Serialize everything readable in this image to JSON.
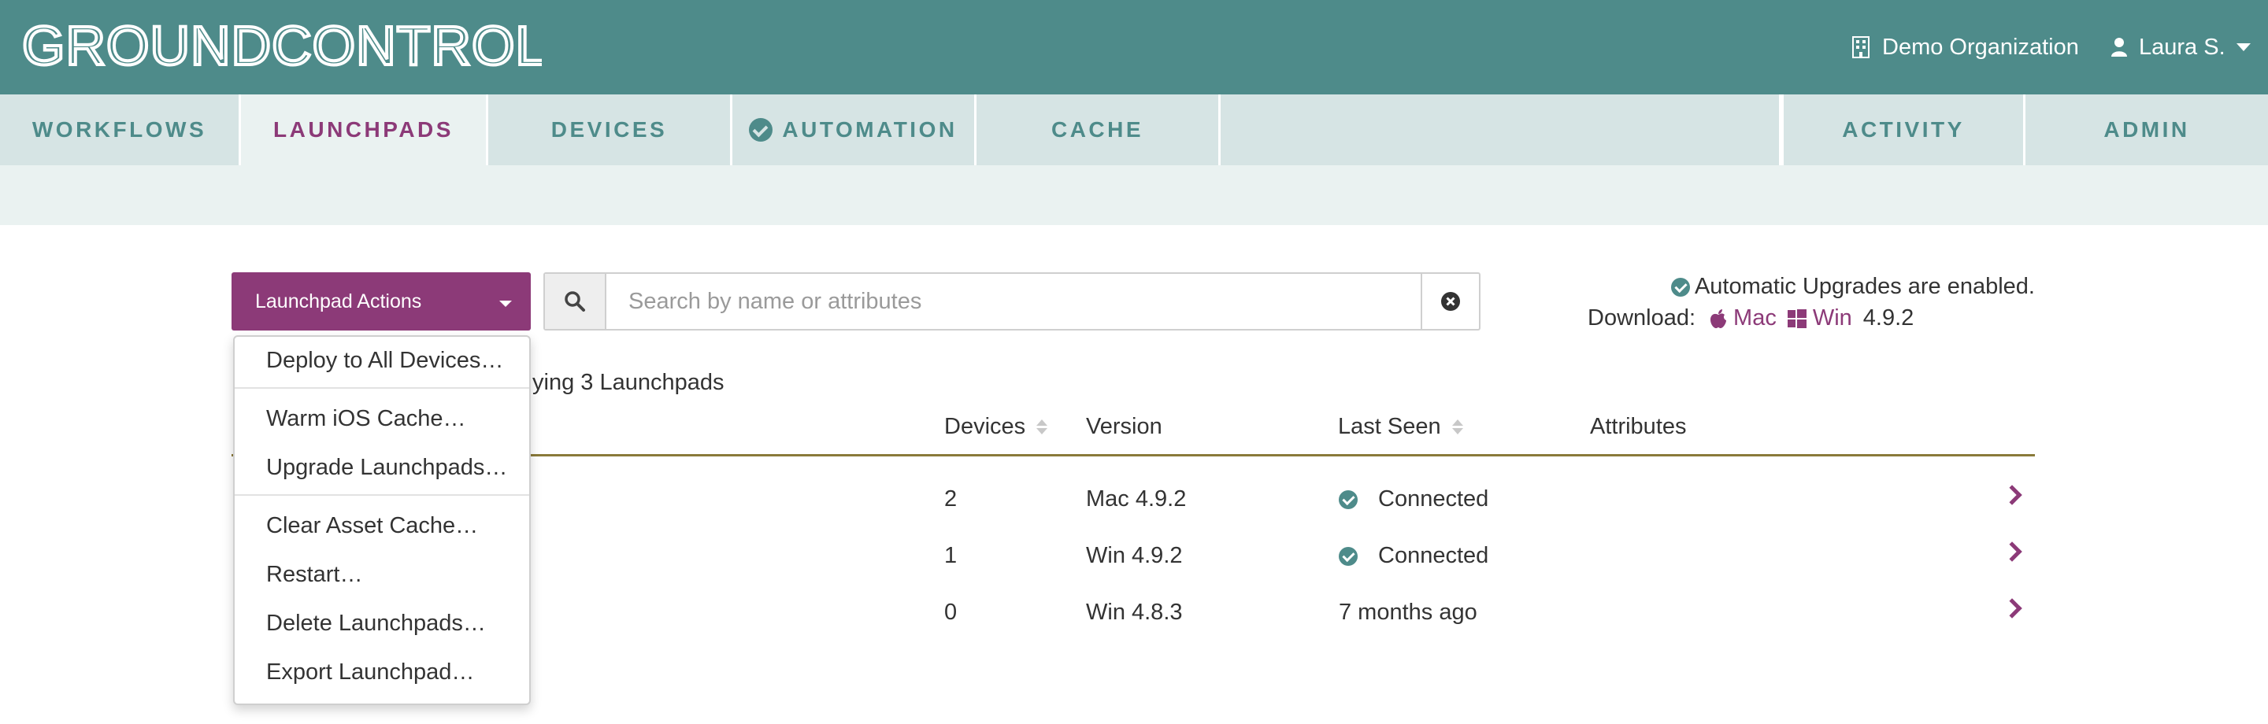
{
  "header": {
    "logo_text": "GROUNDCONTROL",
    "org_label": "Demo Organization",
    "user_label": "Laura S."
  },
  "nav": {
    "tabs": [
      {
        "label": "WORKFLOWS"
      },
      {
        "label": "LAUNCHPADS"
      },
      {
        "label": "DEVICES"
      },
      {
        "label": "AUTOMATION"
      },
      {
        "label": "CACHE"
      },
      {
        "label": "ACTIVITY"
      },
      {
        "label": "ADMIN"
      }
    ]
  },
  "toolbar": {
    "actions_label": "Launchpad Actions",
    "search_placeholder": "Search by name or attributes"
  },
  "status": {
    "upgrades_text": "Automatic Upgrades are enabled.",
    "download_label": "Download:",
    "mac_label": "Mac",
    "win_label": "Win",
    "version": "4.9.2"
  },
  "menu": {
    "items": [
      {
        "label": "Deploy to All Devices…"
      },
      {
        "label": "Warm iOS Cache…"
      },
      {
        "label": "Upgrade Launchpads…"
      },
      {
        "label": "Clear Asset Cache…"
      },
      {
        "label": "Restart…"
      },
      {
        "label": "Delete Launchpads…"
      },
      {
        "label": "Export Launchpad…"
      }
    ]
  },
  "table": {
    "showing_text": "ying 3 Launchpads",
    "columns": {
      "devices": "Devices",
      "version": "Version",
      "last_seen": "Last Seen",
      "attributes": "Attributes"
    },
    "rows": [
      {
        "devices": "2",
        "version": "Mac 4.9.2",
        "last_seen": "Connected",
        "connected": true
      },
      {
        "devices": "1",
        "version": "Win 4.9.2",
        "last_seen": "Connected",
        "connected": true
      },
      {
        "devices": "0",
        "version": "Win 4.8.3",
        "last_seen": "7 months ago",
        "connected": false
      }
    ]
  },
  "colors": {
    "header_teal": "#4e8b8a",
    "brand_purple": "#8c3a78",
    "nav_bg": "#d6e4e4",
    "table_rule": "#8a7a3a"
  }
}
